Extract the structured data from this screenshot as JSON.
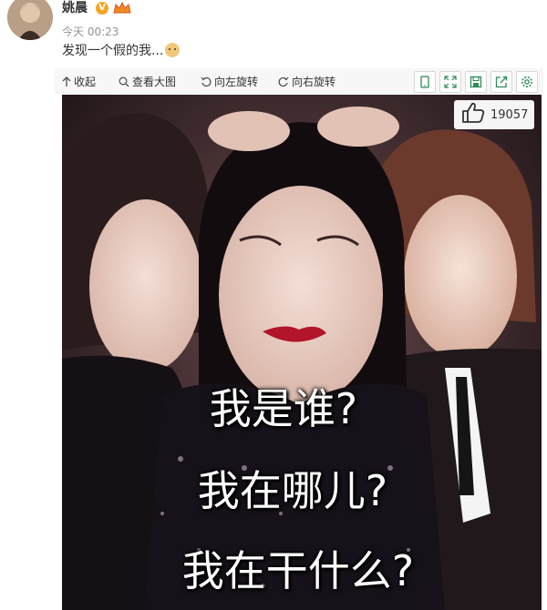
{
  "post": {
    "username": "姚晨",
    "verified_badge": "V",
    "timestamp": "今天 00:23",
    "text": "发现一个假的我..."
  },
  "toolbar": {
    "collapse_label": "收起",
    "view_large_label": "查看大图",
    "rotate_left_label": "向左旋转",
    "rotate_right_label": "向右旋转",
    "icons": [
      "mobile-icon",
      "fullscreen-icon",
      "save-icon",
      "share-icon",
      "settings-icon"
    ]
  },
  "image": {
    "like_count": "19057",
    "caption_lines": [
      "我是谁?",
      "我在哪儿?",
      "我在干什么?"
    ]
  },
  "colors": {
    "accent": "#f5a623",
    "toolbar_bg": "#f7f7f7",
    "icon_green": "#2e8b57"
  }
}
